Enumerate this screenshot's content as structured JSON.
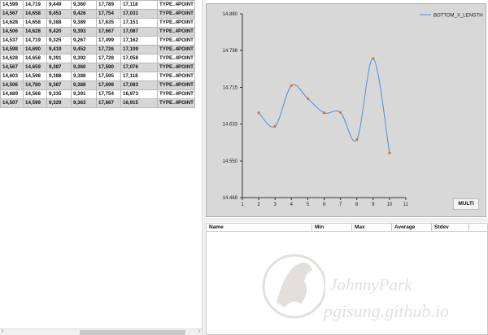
{
  "table": {
    "rows": [
      [
        "14,599",
        "14,719",
        "9,449",
        "9,360",
        "17,789",
        "17,118",
        "TYPE..4POINT"
      ],
      [
        "14,567",
        "14,658",
        "9,453",
        "9,426",
        "17,754",
        "17,031",
        "TYPE..4POINT"
      ],
      [
        "14,628",
        "14,658",
        "9,388",
        "9,389",
        "17,635",
        "17,151",
        "TYPE..4POINT"
      ],
      [
        "14,506",
        "14,628",
        "9,420",
        "9,393",
        "17,667",
        "17,087",
        "TYPE..4POINT"
      ],
      [
        "14,537",
        "14,719",
        "9,325",
        "9,267",
        "17,499",
        "17,162",
        "TYPE..4POINT"
      ],
      [
        "14,598",
        "14,690",
        "9,419",
        "9,452",
        "17,726",
        "17,109",
        "TYPE..4POINT"
      ],
      [
        "14,628",
        "14,658",
        "9,391",
        "9,392",
        "17,728",
        "17,058",
        "TYPE..4POINT"
      ],
      [
        "14,567",
        "14,659",
        "9,387",
        "9,360",
        "17,590",
        "17,076",
        "TYPE..4POINT"
      ],
      [
        "14,603",
        "14,598",
        "9,388",
        "9,388",
        "17,595",
        "17,118",
        "TYPE..4POINT"
      ],
      [
        "14,506",
        "14,780",
        "9,387",
        "9,388",
        "17,698",
        "17,083",
        "TYPE..4POINT"
      ],
      [
        "14,689",
        "14,568",
        "9,335",
        "9,391",
        "17,754",
        "16,973",
        "TYPE..4POINT"
      ],
      [
        "14,507",
        "14,599",
        "9,329",
        "9,363",
        "17,667",
        "16,915",
        "TYPE..4POINT"
      ]
    ]
  },
  "chart_data": {
    "type": "line",
    "series": [
      {
        "name": "BOTTOM_X_LENGTH",
        "x": [
          2,
          3,
          4,
          5,
          6,
          7,
          8,
          9,
          10
        ],
        "y": [
          14.658,
          14.628,
          14.719,
          14.69,
          14.658,
          14.659,
          14.598,
          14.78,
          14.568
        ]
      }
    ],
    "xlim": [
      1,
      11
    ],
    "ylim": [
      14.468,
      14.88
    ],
    "xticks": [
      "1",
      "2",
      "3",
      "4",
      "5",
      "6",
      "7",
      "8",
      "9",
      "10",
      "11"
    ],
    "yticks": [
      "14.880",
      "14.798",
      "14.715",
      "14.633",
      "14.550",
      "14.468"
    ],
    "legend": "top-right",
    "grid": false,
    "line_color": "#4a90d9",
    "marker_color": "#e07030"
  },
  "chart_button": "MULTI",
  "stats": {
    "columns": [
      "Name",
      "Min",
      "Max",
      "Average",
      "Stdev"
    ]
  },
  "watermark": {
    "line1": "JohnnyPark",
    "line2": "pgisung.github.io"
  }
}
